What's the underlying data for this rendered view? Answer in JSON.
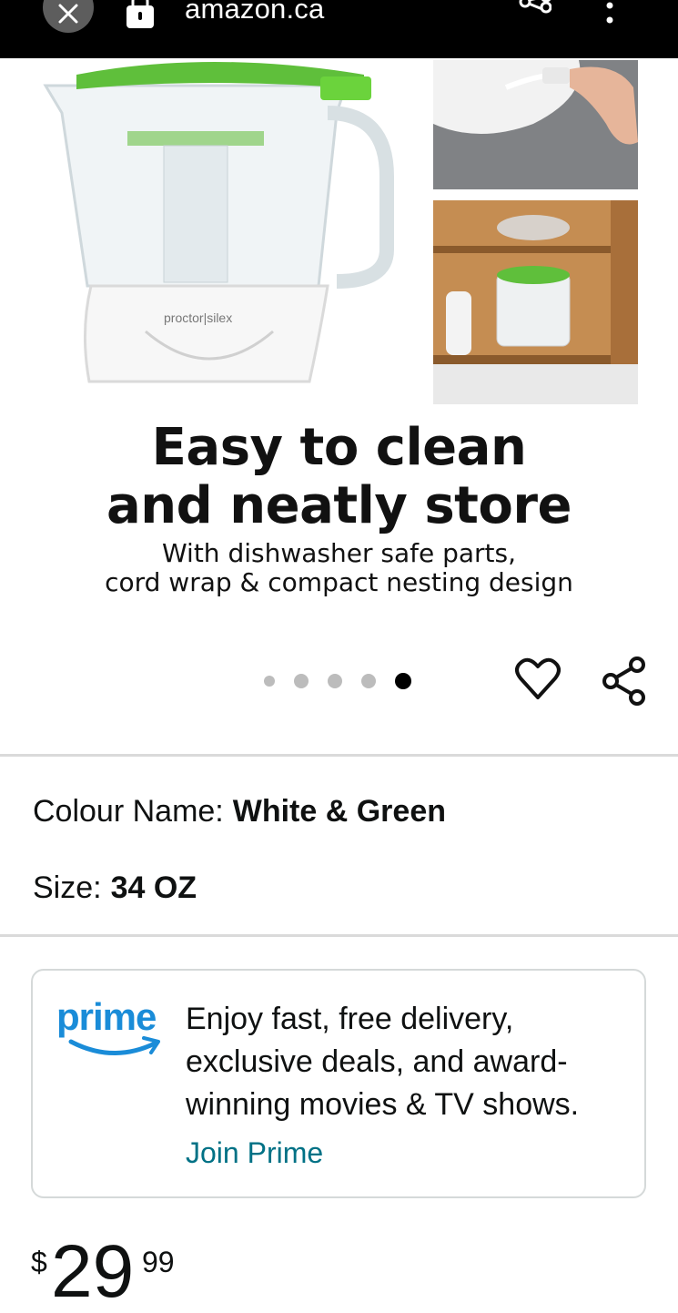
{
  "browser": {
    "url": "amazon.ca"
  },
  "product_image": {
    "headline_line1": "Easy to clean",
    "headline_line2": "and neatly store",
    "subline_line1": "With dishwasher safe parts,",
    "subline_line2": "cord wrap & compact nesting design",
    "brand_label": "proctor|silex"
  },
  "carousel": {
    "total_images": 5,
    "active_index": 5
  },
  "variations": {
    "colour_label": "Colour Name:",
    "colour_value": "White & Green",
    "size_label": "Size:",
    "size_value": "34 OZ"
  },
  "prime": {
    "logo_text": "prime",
    "message": "Enjoy fast, free delivery, exclusive deals, and award-winning movies & TV shows.",
    "join_label": "Join Prime",
    "brand_color": "#1a8cd8",
    "link_color": "#007185"
  },
  "price": {
    "symbol": "$",
    "whole": "29",
    "fraction": "99"
  }
}
